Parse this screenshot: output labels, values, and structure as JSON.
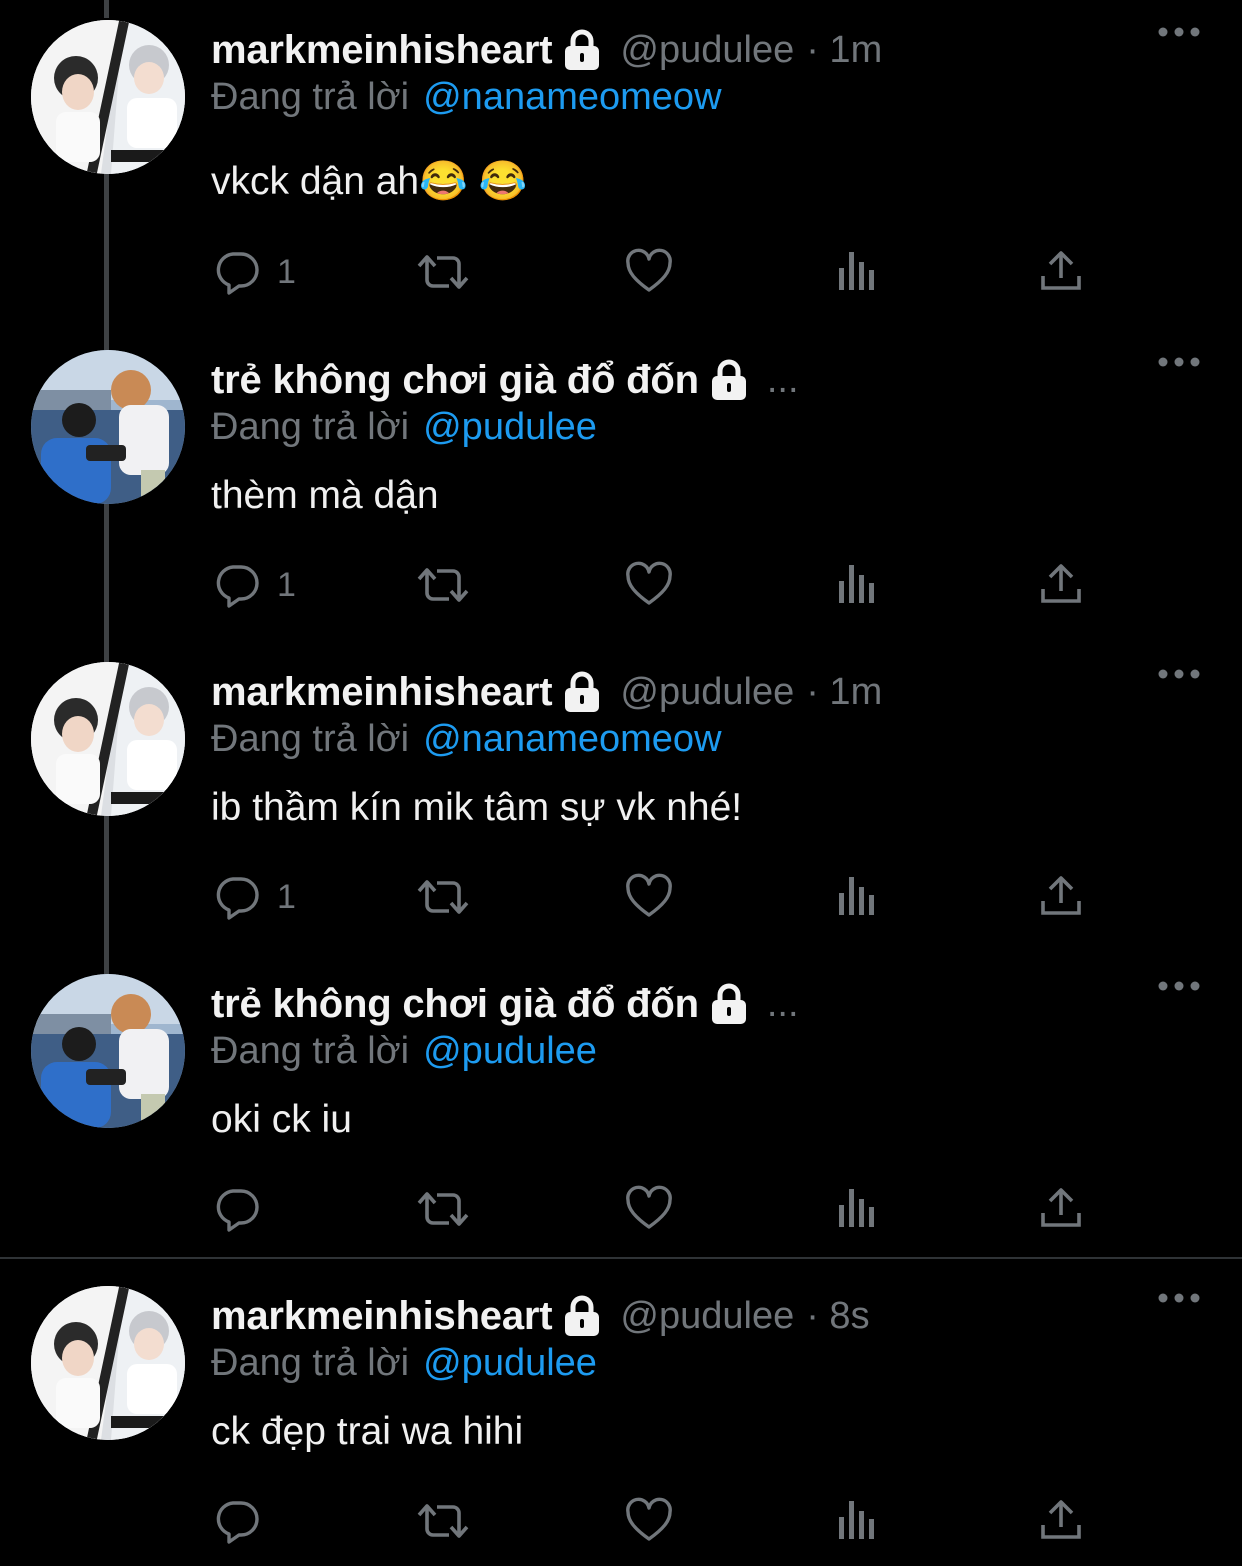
{
  "colors": {
    "background": "#000000",
    "text": "#e7e9ea",
    "muted": "#71767b",
    "link": "#1d9bf0"
  },
  "tweets": [
    {
      "name": "markmeinhisheart",
      "handle": "@pudulee",
      "time": "· 1m",
      "reply_prefix": "Đang trả lời",
      "reply_to": "@nanameomeow",
      "text": "vkck dận ah😂 😂",
      "reply_count": "1",
      "avatar": "avatar-a",
      "lock_icon": "lock-icon"
    },
    {
      "name": "trẻ không chơi già đổ đốn",
      "handle": "",
      "time": "...",
      "reply_prefix": "Đang trả lời",
      "reply_to": "@pudulee",
      "text": "thèm mà dận",
      "reply_count": "1",
      "avatar": "avatar-b",
      "lock_icon": "lock-icon"
    },
    {
      "name": "markmeinhisheart",
      "handle": "@pudulee",
      "time": "· 1m",
      "reply_prefix": "Đang trả lời",
      "reply_to": "@nanameomeow",
      "text": "ib thầm kín mik tâm sự vk nhé!",
      "reply_count": "1",
      "avatar": "avatar-a",
      "lock_icon": "lock-icon"
    },
    {
      "name": "trẻ không chơi già đổ đốn",
      "handle": "",
      "time": "...",
      "reply_prefix": "Đang trả lời",
      "reply_to": "@pudulee",
      "text": "oki ck iu",
      "reply_count": "",
      "avatar": "avatar-b",
      "lock_icon": "lock-icon"
    },
    {
      "name": "markmeinhisheart",
      "handle": "@pudulee",
      "time": "· 8s",
      "reply_prefix": "Đang trả lời",
      "reply_to": "@pudulee",
      "text": "ck đẹp trai wa hihi",
      "reply_count": "",
      "avatar": "avatar-a",
      "lock_icon": "lock-icon"
    }
  ]
}
